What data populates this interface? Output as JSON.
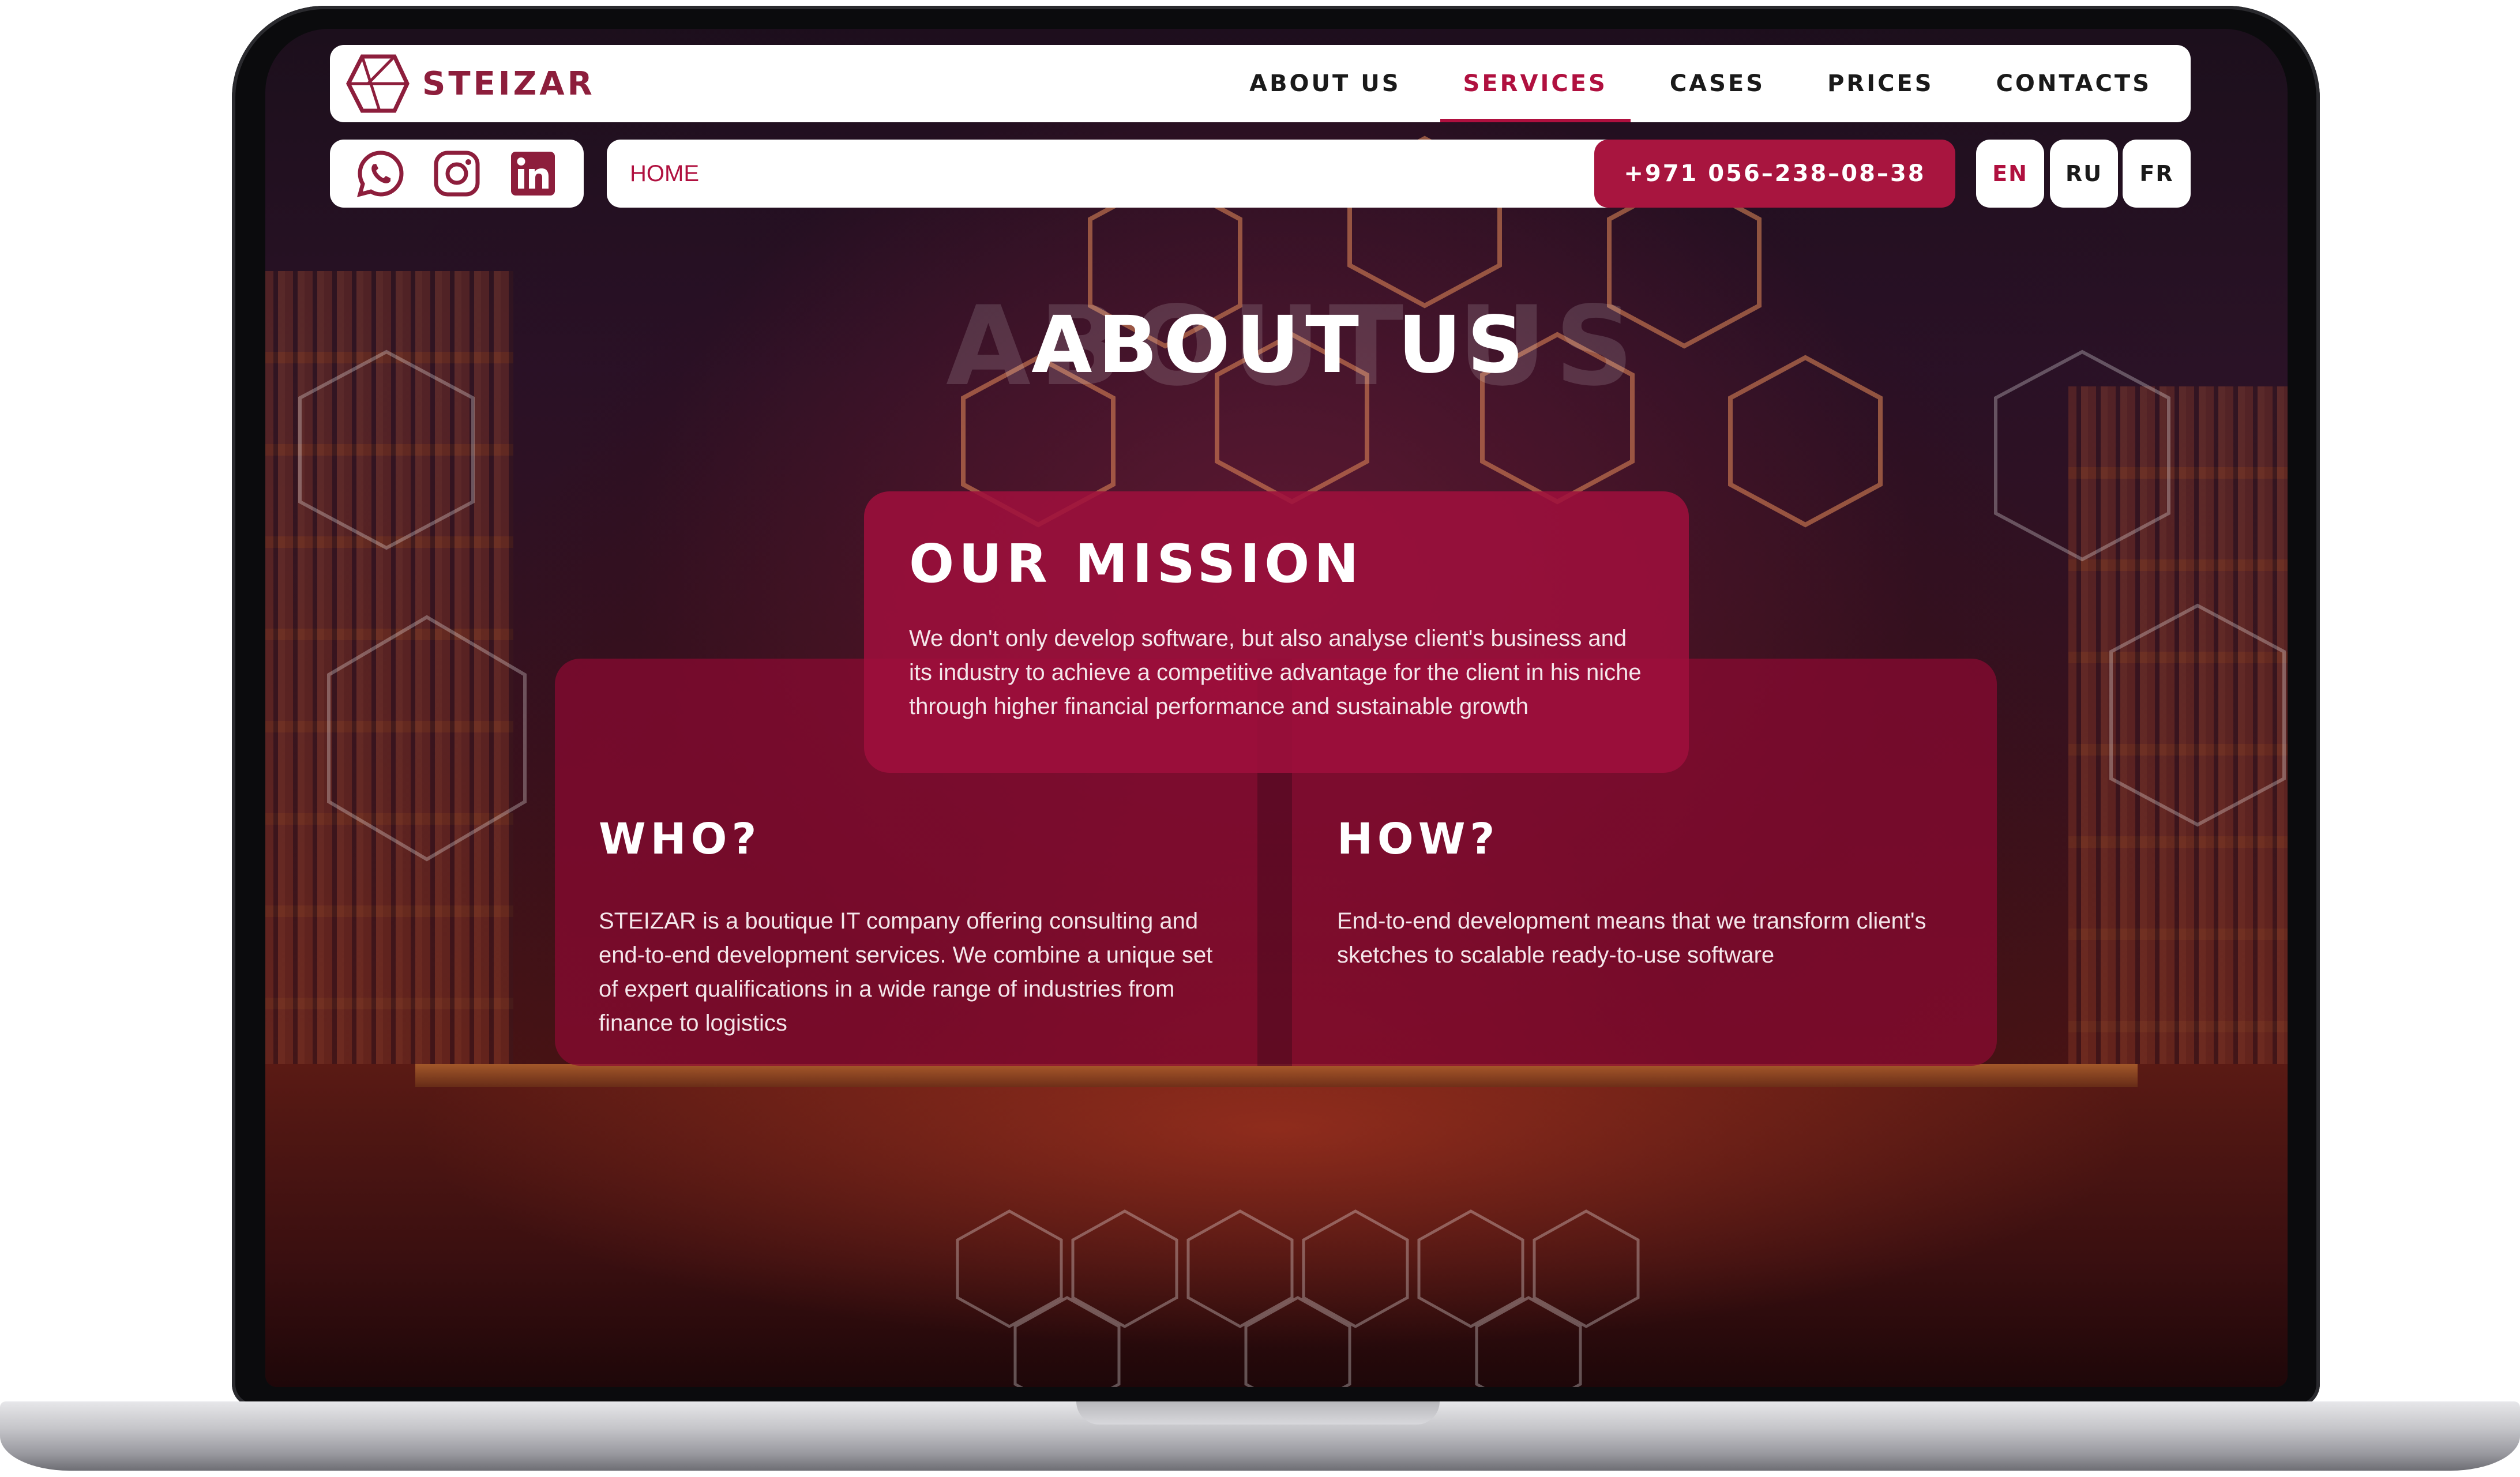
{
  "brand": {
    "name": "STEIZAR",
    "color": "#8d1e3c",
    "accent": "#b0103f"
  },
  "nav": {
    "items": [
      {
        "label": "ABOUT US",
        "active": false
      },
      {
        "label": "SERVICES",
        "active": true
      },
      {
        "label": "CASES",
        "active": false
      },
      {
        "label": "PRICES",
        "active": false
      },
      {
        "label": "CONTACTS",
        "active": false
      }
    ]
  },
  "social": {
    "icons": [
      "whatsapp-icon",
      "instagram-icon",
      "linkedin-icon"
    ]
  },
  "breadcrumb": {
    "home": "HOME"
  },
  "phone": "+971 056–238–08–38",
  "languages": [
    {
      "code": "EN",
      "active": true
    },
    {
      "code": "RU",
      "active": false
    },
    {
      "code": "FR",
      "active": false
    }
  ],
  "hero": {
    "title": "ABOUT US"
  },
  "mission": {
    "title": "OUR MISSION",
    "text": "We don't only develop software, but also analyse client's business and its industry to achieve a competitive advantage for the client in his niche through higher financial performance and sustainable growth"
  },
  "who": {
    "title": "WHO?",
    "text": "STEIZAR is a boutique IT company offering consulting and end-to-end development services. We combine a unique set of expert qualifications in a wide range of industries from finance to logistics"
  },
  "how": {
    "title": "HOW?",
    "text": "End-to-end development means that we transform client's sketches to scalable ready-to-use software"
  }
}
